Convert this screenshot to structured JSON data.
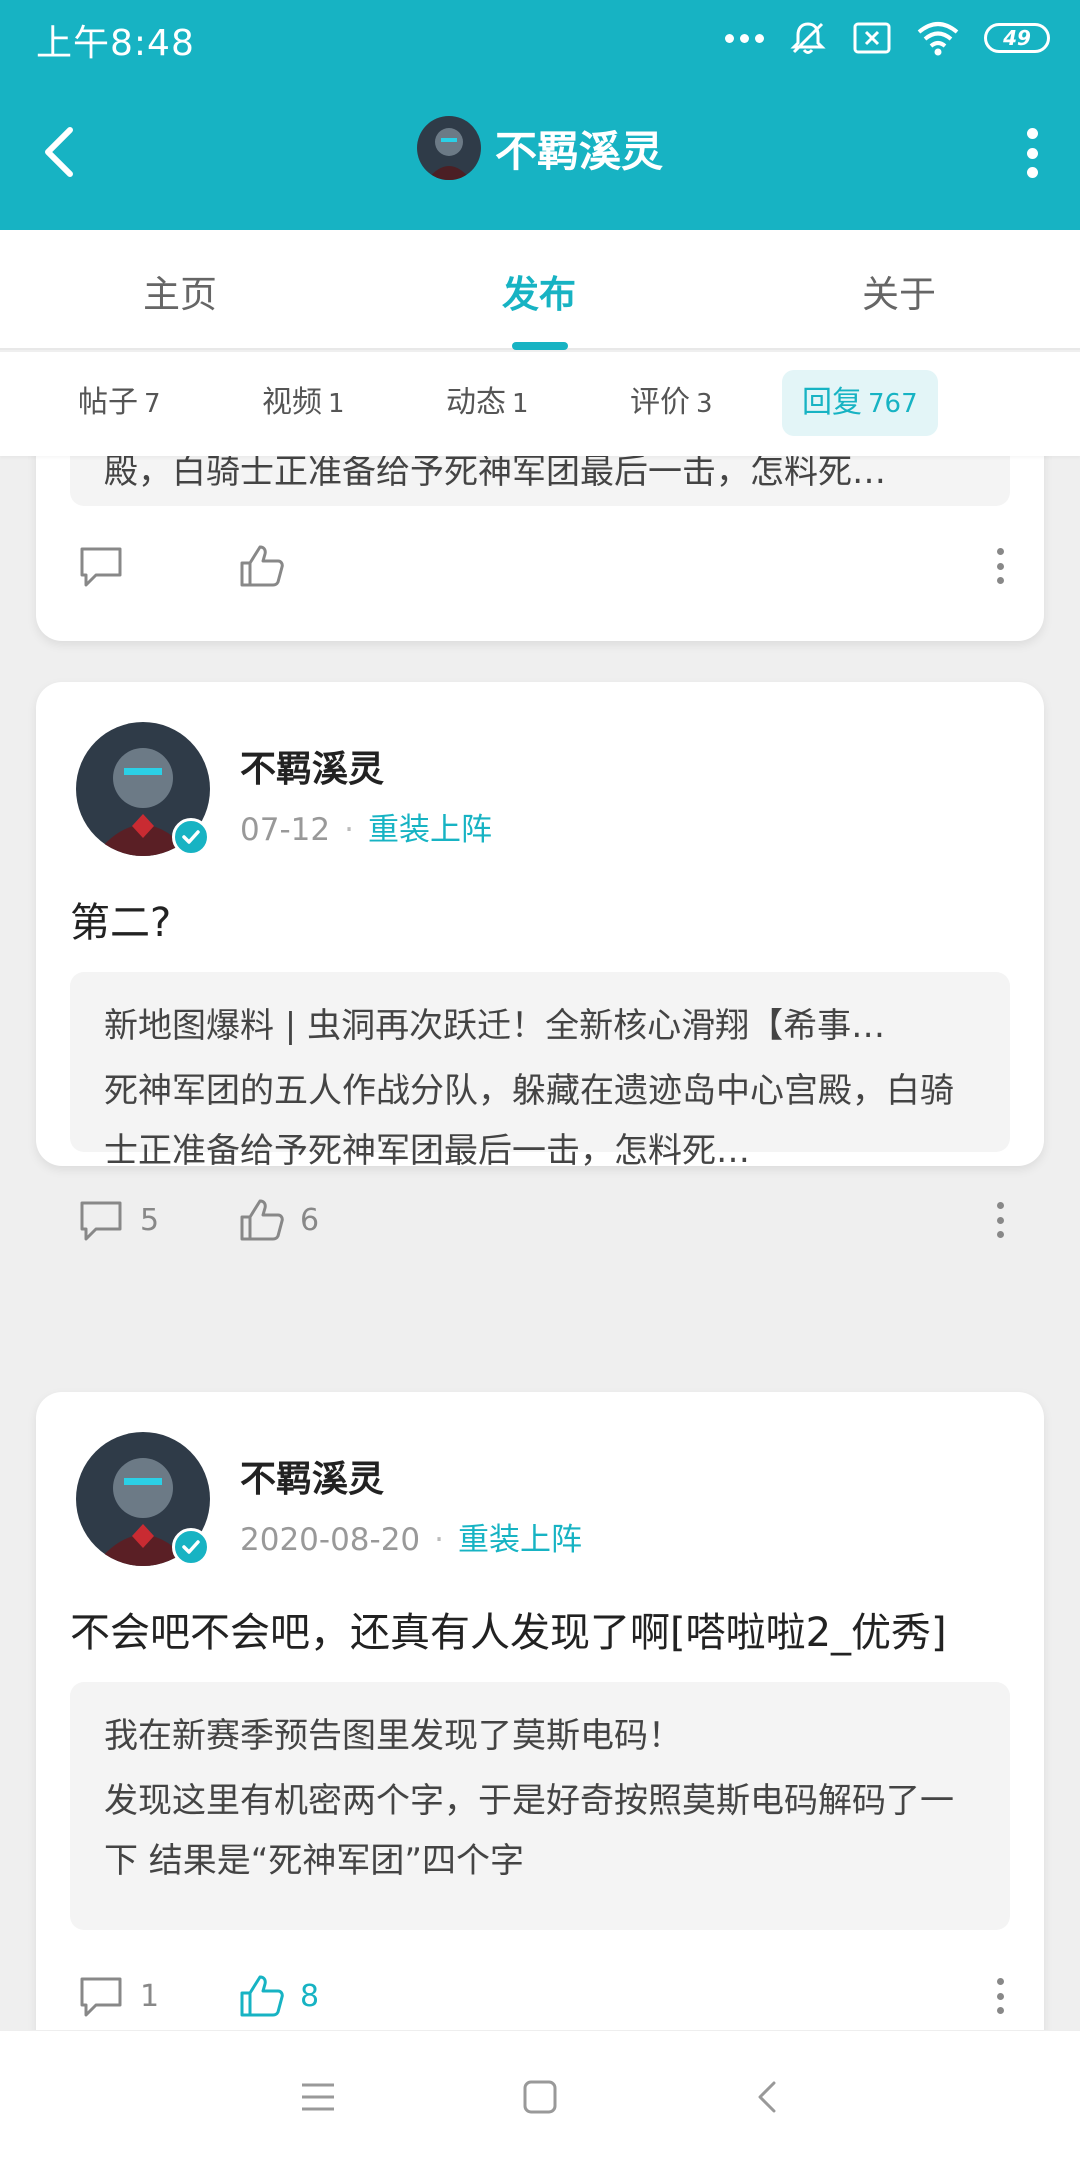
{
  "status_bar": {
    "time": "上午8:48",
    "battery": "49",
    "icons": [
      "more-dots-icon",
      "mute-bell-icon",
      "no-sim-icon",
      "wifi-icon",
      "battery-icon"
    ]
  },
  "header": {
    "title": "不羁溪灵",
    "back_icon": "back-arrow-icon",
    "more_icon": "more-vertical-icon"
  },
  "tabs": [
    {
      "label": "主页",
      "active": false
    },
    {
      "label": "发布",
      "active": true
    },
    {
      "label": "关于",
      "active": false
    }
  ],
  "subtabs": [
    {
      "label": "帖子",
      "count": "7",
      "active": false
    },
    {
      "label": "视频",
      "count": "1",
      "active": false
    },
    {
      "label": "动态",
      "count": "1",
      "active": false
    },
    {
      "label": "评价",
      "count": "3",
      "active": false
    },
    {
      "label": "回复",
      "count": "767",
      "active": true
    }
  ],
  "posts": [
    {
      "partial": true,
      "quote_tail": "殿，白骑士正准备给予死神军团最后一击，怎料死…",
      "comments": "",
      "likes": "",
      "liked": false
    },
    {
      "author": "不羁溪灵",
      "date": "07-12",
      "tag": "重装上阵",
      "text": "第二?",
      "quote_title": "新地图爆料 | 虫洞再次跃迁！全新核心滑翔【希事…",
      "quote_body": "死神军团的五人作战分队，躲藏在遗迹岛中心宫殿，白骑士正准备给予死神军团最后一击，怎料死…",
      "comments": "5",
      "likes": "6",
      "liked": false
    },
    {
      "author": "不羁溪灵",
      "date": "2020-08-20",
      "tag": "重装上阵",
      "text": "不会吧不会吧，还真有人发现了啊[嗒啦啦2_优秀]",
      "quote_title": "我在新赛季预告图里发现了莫斯电码！",
      "quote_body": "发现这里有机密两个字，于是好奇按照莫斯电码解码了一下 结果是“死神军团”四个字",
      "comments": "1",
      "likes": "8",
      "liked": true
    }
  ],
  "colors": {
    "accent": "#17b3c3",
    "background": "#efefef",
    "card": "#ffffff",
    "quote_bg": "#f4f4f4"
  },
  "nav_bar": [
    "menu-icon",
    "home-square-icon",
    "back-chevron-icon"
  ]
}
